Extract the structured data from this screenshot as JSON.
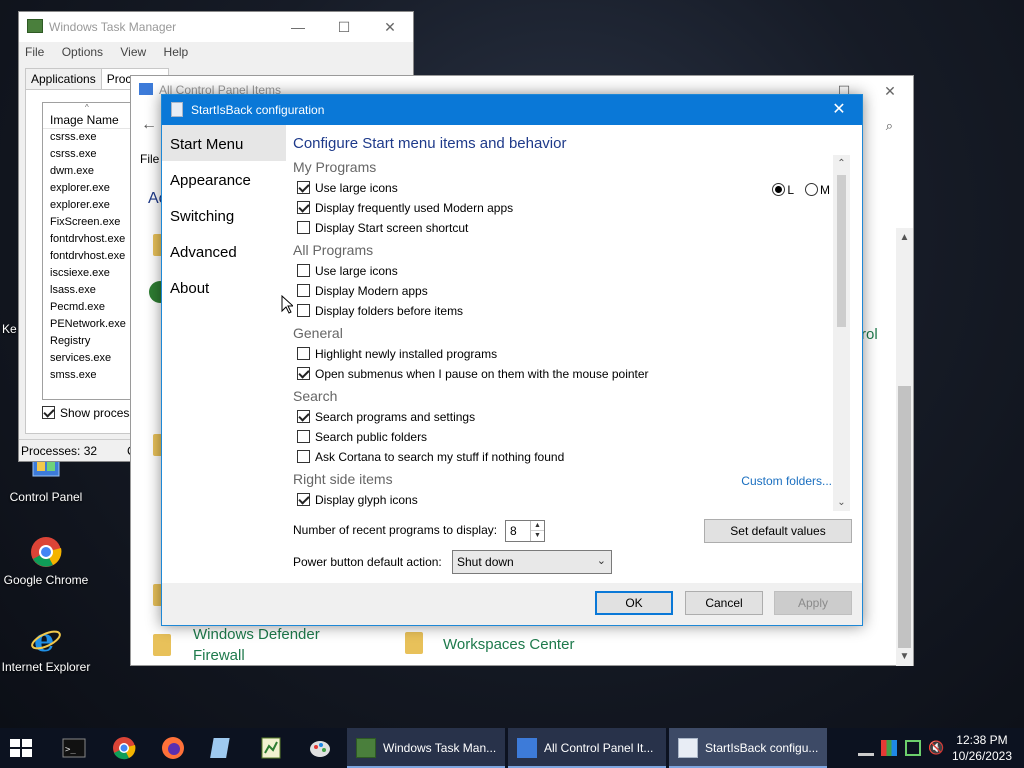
{
  "desktop": {
    "icons": [
      {
        "label": "Control Panel"
      },
      {
        "label": "Google Chrome"
      },
      {
        "label": "Internet Explorer"
      }
    ],
    "edge_text": "Ke"
  },
  "task_manager": {
    "title": "Windows Task Manager",
    "menu": [
      "File",
      "Options",
      "View",
      "Help"
    ],
    "tabs": [
      "Applications",
      "Processes"
    ],
    "column_header": "Image Name",
    "processes": [
      "csrss.exe",
      "csrss.exe",
      "dwm.exe",
      "explorer.exe",
      "explorer.exe",
      "FixScreen.exe",
      "fontdrvhost.exe",
      "fontdrvhost.exe",
      "iscsiexe.exe",
      "lsass.exe",
      "Pecmd.exe",
      "PENetwork.exe",
      "Registry",
      "services.exe",
      "smss.exe"
    ],
    "show_processes_label": "Show processe",
    "status": "Processes: 32",
    "status_extra": "C"
  },
  "control_panel": {
    "title": "All Control Panel Items",
    "menu_file": "File",
    "partial_heading": "Ac",
    "partial_item": "rol",
    "items": [
      "Windows Defender Firewall",
      "Workspaces Center"
    ],
    "item1_line1": "Windows Defender",
    "item1_line2": "Firewall"
  },
  "dialog": {
    "title": "StartIsBack configuration",
    "close": "✕",
    "sidebar": [
      "Start Menu",
      "Appearance",
      "Switching",
      "Advanced",
      "About"
    ],
    "selected_sidebar": "Start Menu",
    "heading": "Configure Start menu items and behavior",
    "sections": [
      {
        "title": "My Programs",
        "options": [
          {
            "label": "Use large icons",
            "checked": true
          },
          {
            "label": "Display frequently used Modern apps",
            "checked": true
          },
          {
            "label": "Display Start screen shortcut",
            "checked": false
          }
        ]
      },
      {
        "title": "All Programs",
        "options": [
          {
            "label": "Use large icons",
            "checked": false
          },
          {
            "label": "Display Modern apps",
            "checked": false
          },
          {
            "label": "Display folders before items",
            "checked": false
          }
        ]
      },
      {
        "title": "General",
        "options": [
          {
            "label": "Highlight newly installed programs",
            "checked": false
          },
          {
            "label": "Open submenus when I pause on them with the mouse pointer",
            "checked": true
          }
        ]
      },
      {
        "title": "Search",
        "options": [
          {
            "label": "Search programs and settings",
            "checked": true
          },
          {
            "label": "Search public folders",
            "checked": false
          },
          {
            "label": "Ask Cortana to search my stuff if nothing found",
            "checked": false
          }
        ]
      },
      {
        "title": "Right side items",
        "options": [
          {
            "label": "Display glyph icons",
            "checked": true
          }
        ]
      }
    ],
    "icon_size": {
      "options": [
        "L",
        "M"
      ],
      "selected": "L"
    },
    "custom_folders_link": "Custom folders...",
    "recent_label": "Number of recent programs to display:",
    "recent_value": "8",
    "power_label": "Power button default action:",
    "power_value": "Shut down",
    "set_defaults": "Set default values",
    "ok": "OK",
    "cancel": "Cancel",
    "apply": "Apply"
  },
  "taskbar": {
    "tasks": [
      {
        "label": "Windows Task Man..."
      },
      {
        "label": "All Control Panel It..."
      },
      {
        "label": "StartIsBack configu..."
      }
    ],
    "clock_time": "12:38 PM",
    "clock_date": "10/26/2023"
  },
  "colors": {
    "accent": "#0a78d7",
    "link": "#1a6fc0",
    "control_panel_item": "#1e7a4c"
  }
}
